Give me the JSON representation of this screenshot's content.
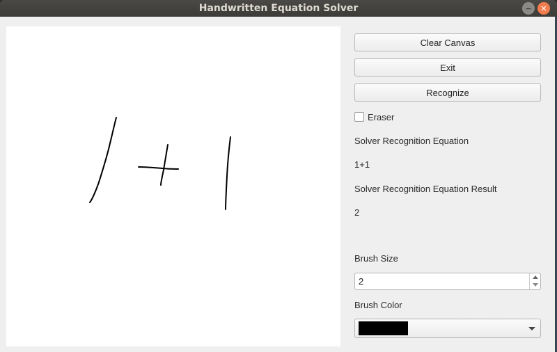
{
  "window": {
    "title": "Handwritten Equation Solver",
    "minimize_symbol": "−",
    "close_symbol": "✕"
  },
  "controls": {
    "clear_label": "Clear Canvas",
    "exit_label": "Exit",
    "recognize_label": "Recognize",
    "eraser_label": "Eraser",
    "eraser_checked": false
  },
  "results": {
    "equation_heading": "Solver Recognition Equation",
    "equation_value": "1+1",
    "result_heading": "Solver Recognition Equation Result",
    "result_value": "2"
  },
  "brush": {
    "size_label": "Brush Size",
    "size_value": "2",
    "color_label": "Brush Color",
    "color_value": "#000000"
  }
}
